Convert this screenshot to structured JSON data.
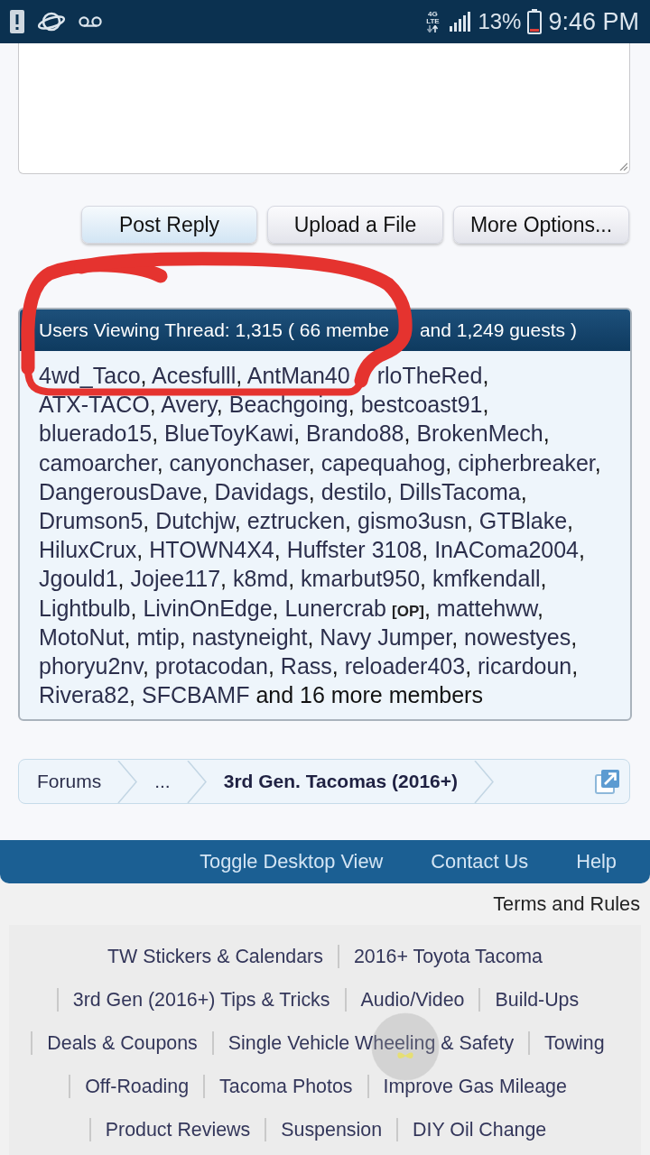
{
  "status_bar": {
    "network": "4G LTE",
    "battery": "13%",
    "time": "9:46 PM"
  },
  "reply_form": {
    "buttons": [
      {
        "label": "Post Reply",
        "primary": true
      },
      {
        "label": "Upload a File",
        "primary": false
      },
      {
        "label": "More Options...",
        "primary": false
      }
    ]
  },
  "users_viewing": {
    "title_parts": [
      "Users Viewing Thread: 1,315 ( 66 membe",
      "and 1,249 guests )"
    ],
    "separator": ", ",
    "members": [
      {
        "name": "4wd_Taco"
      },
      {
        "name": "Acesfulll"
      },
      {
        "name": "AntMan40",
        "cut": true
      },
      {
        "name": "rloTheRed"
      },
      {
        "name": "ATX-TACO"
      },
      {
        "name": "Avery"
      },
      {
        "name": "Beachgoing"
      },
      {
        "name": "bestcoast91"
      },
      {
        "name": "bluerado15"
      },
      {
        "name": "BlueToyKawi"
      },
      {
        "name": "Brando88"
      },
      {
        "name": "BrokenMech"
      },
      {
        "name": "camoarcher"
      },
      {
        "name": "canyonchaser"
      },
      {
        "name": "capequahog"
      },
      {
        "name": "cipherbreaker"
      },
      {
        "name": "DangerousDave"
      },
      {
        "name": "Davidags"
      },
      {
        "name": "destilo"
      },
      {
        "name": "DillsTacoma"
      },
      {
        "name": "Drumson5"
      },
      {
        "name": "Dutchjw"
      },
      {
        "name": "eztrucken"
      },
      {
        "name": "gismo3usn"
      },
      {
        "name": "GTBlake"
      },
      {
        "name": "HiluxCrux"
      },
      {
        "name": "HTOWN4X4"
      },
      {
        "name": "Huffster 3108"
      },
      {
        "name": "InAComa2004"
      },
      {
        "name": "Jgould1"
      },
      {
        "name": "Jojee117"
      },
      {
        "name": "k8md"
      },
      {
        "name": "kmarbut950"
      },
      {
        "name": "kmfkendall"
      },
      {
        "name": "Lightbulb"
      },
      {
        "name": "LivinOnEdge"
      },
      {
        "name": "Lunercrab",
        "badge": "[OP]"
      },
      {
        "name": "mattehww"
      },
      {
        "name": "MotoNut"
      },
      {
        "name": "mtip"
      },
      {
        "name": "nastyneight"
      },
      {
        "name": "Navy Jumper"
      },
      {
        "name": "nowestyes"
      },
      {
        "name": "phoryu2nv"
      },
      {
        "name": "protacodan"
      },
      {
        "name": "Rass"
      },
      {
        "name": "reloader403"
      },
      {
        "name": "ricardoun"
      },
      {
        "name": "Rivera82"
      },
      {
        "name": "SFCBAMF"
      }
    ],
    "more": "and 16 more members"
  },
  "breadcrumb": {
    "items": [
      {
        "label": "Forums",
        "current": false
      },
      {
        "label": "...",
        "current": false
      },
      {
        "label": "3rd Gen. Tacomas (2016+)",
        "current": true
      }
    ]
  },
  "footer": {
    "links": [
      "Toggle Desktop View",
      "Contact Us",
      "Help"
    ],
    "terms": "Terms and Rules",
    "forum_links": [
      "TW Stickers & Calendars",
      "2016+ Toyota Tacoma",
      "3rd Gen (2016+) Tips & Tricks",
      "Audio/Video",
      "Build-Ups",
      "Deals & Coupons",
      "Single Vehicle Wheeling & Safety",
      "Towing",
      "Off-Roading",
      "Tacoma Photos",
      "Improve Gas Mileage",
      "Product Reviews",
      "Suspension",
      "DIY Oil Change"
    ]
  }
}
